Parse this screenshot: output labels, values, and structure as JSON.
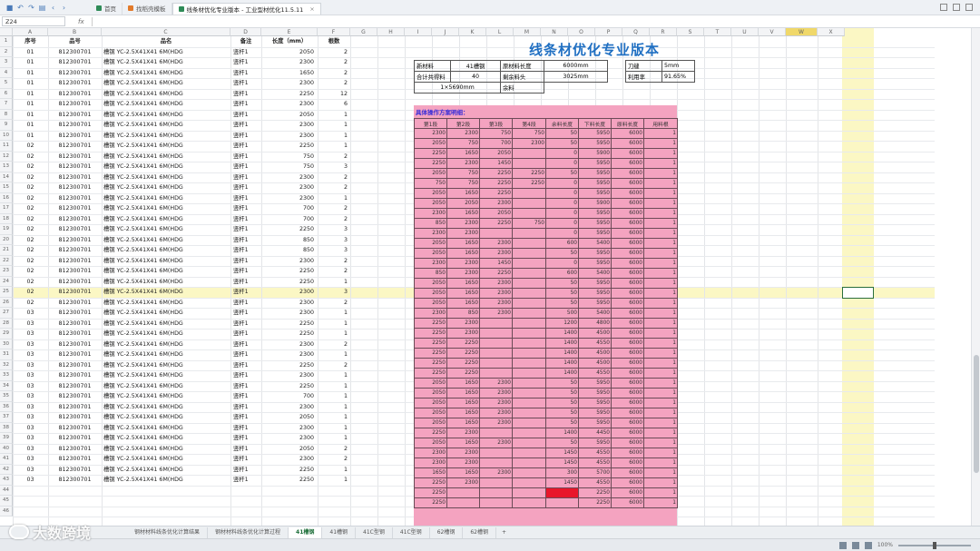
{
  "app": {
    "tabs": [
      {
        "label": "首页",
        "active": false
      },
      {
        "label": "找稻壳模板",
        "active": false
      },
      {
        "label": "线条材优化专业版本 - 工业型材优化11.5.11",
        "active": true
      }
    ]
  },
  "formula_bar": {
    "name_box": "Z24",
    "fx": "fx"
  },
  "columns": [
    "A",
    "B",
    "C",
    "D",
    "E",
    "F",
    "G",
    "H",
    "I",
    "J",
    "K",
    "L",
    "M",
    "N",
    "O",
    "P",
    "Q",
    "R",
    "S",
    "T",
    "U",
    "V",
    "W",
    "X"
  ],
  "table": {
    "headers": {
      "seq": "序号",
      "part": "品号",
      "name": "品名",
      "remark": "备注",
      "length": "长度（mm）",
      "qty": "根数"
    },
    "rows": [
      {
        "seq": "01",
        "part": "812300701",
        "name": "槽钢 YC-2.5X41X41 6M(HDG",
        "rem": "竖杆1",
        "len": "2050",
        "qty": "2"
      },
      {
        "seq": "01",
        "part": "812300701",
        "name": "槽钢 YC-2.5X41X41 6M(HDG",
        "rem": "竖杆1",
        "len": "2300",
        "qty": "2"
      },
      {
        "seq": "01",
        "part": "812300701",
        "name": "槽钢 YC-2.5X41X41 6M(HDG",
        "rem": "竖杆1",
        "len": "1650",
        "qty": "2"
      },
      {
        "seq": "01",
        "part": "812300701",
        "name": "槽钢 YC-2.5X41X41 6M(HDG",
        "rem": "竖杆1",
        "len": "2300",
        "qty": "2"
      },
      {
        "seq": "01",
        "part": "812300701",
        "name": "槽钢 YC-2.5X41X41 6M(HDG",
        "rem": "竖杆1",
        "len": "2250",
        "qty": "12"
      },
      {
        "seq": "01",
        "part": "812300701",
        "name": "槽钢 YC-2.5X41X41 6M(HDG",
        "rem": "竖杆1",
        "len": "2300",
        "qty": "6"
      },
      {
        "seq": "01",
        "part": "812300701",
        "name": "槽钢 YC-2.5X41X41 6M(HDG",
        "rem": "竖杆1",
        "len": "2050",
        "qty": "1"
      },
      {
        "seq": "01",
        "part": "812300701",
        "name": "槽钢 YC-2.5X41X41 6M(HDG",
        "rem": "竖杆1",
        "len": "2300",
        "qty": "1"
      },
      {
        "seq": "01",
        "part": "812300701",
        "name": "槽钢 YC-2.5X41X41 6M(HDG",
        "rem": "竖杆1",
        "len": "2300",
        "qty": "1"
      },
      {
        "seq": "02",
        "part": "812300701",
        "name": "槽钢 YC-2.5X41X41 6M(HDG",
        "rem": "竖杆1",
        "len": "2250",
        "qty": "1"
      },
      {
        "seq": "02",
        "part": "812300701",
        "name": "槽钢 YC-2.5X41X41 6M(HDG",
        "rem": "竖杆1",
        "len": "750",
        "qty": "2"
      },
      {
        "seq": "02",
        "part": "812300701",
        "name": "槽钢 YC-2.5X41X41 6M(HDG",
        "rem": "竖杆1",
        "len": "750",
        "qty": "3"
      },
      {
        "seq": "02",
        "part": "812300701",
        "name": "槽钢 YC-2.5X41X41 6M(HDG",
        "rem": "竖杆1",
        "len": "2300",
        "qty": "2"
      },
      {
        "seq": "02",
        "part": "812300701",
        "name": "槽钢 YC-2.5X41X41 6M(HDG",
        "rem": "竖杆1",
        "len": "2300",
        "qty": "2"
      },
      {
        "seq": "02",
        "part": "812300701",
        "name": "槽钢 YC-2.5X41X41 6M(HDG",
        "rem": "竖杆1",
        "len": "2300",
        "qty": "1"
      },
      {
        "seq": "02",
        "part": "812300701",
        "name": "槽钢 YC-2.5X41X41 6M(HDG",
        "rem": "竖杆1",
        "len": "700",
        "qty": "2"
      },
      {
        "seq": "02",
        "part": "812300701",
        "name": "槽钢 YC-2.5X41X41 6M(HDG",
        "rem": "竖杆1",
        "len": "700",
        "qty": "2"
      },
      {
        "seq": "02",
        "part": "812300701",
        "name": "槽钢 YC-2.5X41X41 6M(HDG",
        "rem": "竖杆1",
        "len": "2250",
        "qty": "3"
      },
      {
        "seq": "02",
        "part": "812300701",
        "name": "槽钢 YC-2.5X41X41 6M(HDG",
        "rem": "竖杆1",
        "len": "850",
        "qty": "3"
      },
      {
        "seq": "02",
        "part": "812300701",
        "name": "槽钢 YC-2.5X41X41 6M(HDG",
        "rem": "竖杆1",
        "len": "850",
        "qty": "3"
      },
      {
        "seq": "02",
        "part": "812300701",
        "name": "槽钢 YC-2.5X41X41 6M(HDG",
        "rem": "竖杆1",
        "len": "2300",
        "qty": "2"
      },
      {
        "seq": "02",
        "part": "812300701",
        "name": "槽钢 YC-2.5X41X41 6M(HDG",
        "rem": "竖杆1",
        "len": "2250",
        "qty": "2"
      },
      {
        "seq": "02",
        "part": "812300701",
        "name": "槽钢 YC-2.5X41X41 6M(HDG",
        "rem": "竖杆1",
        "len": "2250",
        "qty": "1"
      },
      {
        "seq": "02",
        "part": "812300701",
        "name": "槽钢 YC-2.5X41X41 6M(HDG",
        "rem": "竖杆1",
        "len": "2300",
        "qty": "3"
      },
      {
        "seq": "02",
        "part": "812300701",
        "name": "槽钢 YC-2.5X41X41 6M(HDG",
        "rem": "竖杆1",
        "len": "2300",
        "qty": "2"
      },
      {
        "seq": "03",
        "part": "812300701",
        "name": "槽钢 YC-2.5X41X41 6M(HDG",
        "rem": "竖杆1",
        "len": "2300",
        "qty": "1"
      },
      {
        "seq": "03",
        "part": "812300701",
        "name": "槽钢 YC-2.5X41X41 6M(HDG",
        "rem": "竖杆1",
        "len": "2250",
        "qty": "1"
      },
      {
        "seq": "03",
        "part": "812300701",
        "name": "槽钢 YC-2.5X41X41 6M(HDG",
        "rem": "竖杆1",
        "len": "2250",
        "qty": "1"
      },
      {
        "seq": "03",
        "part": "812300701",
        "name": "槽钢 YC-2.5X41X41 6M(HDG",
        "rem": "竖杆1",
        "len": "2300",
        "qty": "2"
      },
      {
        "seq": "03",
        "part": "812300701",
        "name": "槽钢 YC-2.5X41X41 6M(HDG",
        "rem": "竖杆1",
        "len": "2300",
        "qty": "1"
      },
      {
        "seq": "03",
        "part": "812300701",
        "name": "槽钢 YC-2.5X41X41 6M(HDG",
        "rem": "竖杆1",
        "len": "2250",
        "qty": "2"
      },
      {
        "seq": "03",
        "part": "812300701",
        "name": "槽钢 YC-2.5X41X41 6M(HDG",
        "rem": "竖杆1",
        "len": "2300",
        "qty": "1"
      },
      {
        "seq": "03",
        "part": "812300701",
        "name": "槽钢 YC-2.5X41X41 6M(HDG",
        "rem": "竖杆1",
        "len": "2250",
        "qty": "1"
      },
      {
        "seq": "03",
        "part": "812300701",
        "name": "槽钢 YC-2.5X41X41 6M(HDG",
        "rem": "竖杆1",
        "len": "700",
        "qty": "1"
      },
      {
        "seq": "03",
        "part": "812300701",
        "name": "槽钢 YC-2.5X41X41 6M(HDG",
        "rem": "竖杆1",
        "len": "2300",
        "qty": "1"
      },
      {
        "seq": "03",
        "part": "812300701",
        "name": "槽钢 YC-2.5X41X41 6M(HDG",
        "rem": "竖杆1",
        "len": "2050",
        "qty": "1"
      },
      {
        "seq": "03",
        "part": "812300701",
        "name": "槽钢 YC-2.5X41X41 6M(HDG",
        "rem": "竖杆1",
        "len": "2300",
        "qty": "1"
      },
      {
        "seq": "03",
        "part": "812300701",
        "name": "槽钢 YC-2.5X41X41 6M(HDG",
        "rem": "竖杆1",
        "len": "2300",
        "qty": "1"
      },
      {
        "seq": "03",
        "part": "812300701",
        "name": "槽钢 YC-2.5X41X41 6M(HDG",
        "rem": "竖杆1",
        "len": "2050",
        "qty": "2"
      },
      {
        "seq": "03",
        "part": "812300701",
        "name": "槽钢 YC-2.5X41X41 6M(HDG",
        "rem": "竖杆1",
        "len": "2300",
        "qty": "2"
      },
      {
        "seq": "03",
        "part": "812300701",
        "name": "槽钢 YC-2.5X41X41 6M(HDG",
        "rem": "竖杆1",
        "len": "2250",
        "qty": "1"
      },
      {
        "seq": "03",
        "part": "812300701",
        "name": "槽钢 YC-2.5X41X41 6M(HDG",
        "rem": "竖杆1",
        "len": "2250",
        "qty": "1"
      }
    ]
  },
  "panel": {
    "title": "线条材优化专业版本",
    "info": {
      "material_label": "新材料",
      "material_value": "41槽钢",
      "stock_len_label": "原材料长度",
      "stock_len_value": "6000mm",
      "blade_label": "刀缝",
      "blade_value": "5mm",
      "total_label": "合计共得料",
      "total_value": "40",
      "surplus_label": "剩余料头",
      "surplus_value": "3025mm",
      "rate_label": "利用率",
      "rate_value": "91.65%",
      "extra_value": "1×5690mm",
      "extra_label": "余料"
    },
    "plan_title": "具体操作方案明细：",
    "plan_headers": [
      "第1段",
      "第2段",
      "第3段",
      "第4段",
      "余料长度",
      "下料长度",
      "原料长度",
      "用料根"
    ],
    "plan_rows": [
      [
        "2300",
        "2300",
        "750",
        "750",
        "50",
        "5950",
        "6000",
        "1"
      ],
      [
        "2050",
        "750",
        "700",
        "2300",
        "50",
        "5950",
        "6000",
        "1"
      ],
      [
        "2250",
        "1650",
        "2050",
        "",
        "0",
        "5900",
        "6000",
        "1"
      ],
      [
        "2250",
        "2300",
        "1450",
        "",
        "0",
        "5950",
        "6000",
        "1"
      ],
      [
        "2050",
        "750",
        "2250",
        "2250",
        "50",
        "5950",
        "6000",
        "1"
      ],
      [
        "750",
        "750",
        "2250",
        "2250",
        "0",
        "5950",
        "6000",
        "1"
      ],
      [
        "2050",
        "1650",
        "2250",
        "",
        "0",
        "5950",
        "6000",
        "1"
      ],
      [
        "2050",
        "2050",
        "2300",
        "",
        "0",
        "5900",
        "6000",
        "1"
      ],
      [
        "2300",
        "1650",
        "2050",
        "",
        "0",
        "5950",
        "6000",
        "1"
      ],
      [
        "850",
        "2300",
        "2250",
        "750",
        "0",
        "5950",
        "6000",
        "1"
      ],
      [
        "2300",
        "2300",
        "",
        "",
        "0",
        "5950",
        "6000",
        "1"
      ],
      [
        "2050",
        "1650",
        "2300",
        "",
        "600",
        "5400",
        "6000",
        "1"
      ],
      [
        "2050",
        "1650",
        "2300",
        "",
        "50",
        "5950",
        "6000",
        "1"
      ],
      [
        "2300",
        "2300",
        "1450",
        "",
        "0",
        "5950",
        "6000",
        "1"
      ],
      [
        "850",
        "2300",
        "2250",
        "",
        "600",
        "5400",
        "6000",
        "1"
      ],
      [
        "2050",
        "1650",
        "2300",
        "",
        "50",
        "5950",
        "6000",
        "1"
      ],
      [
        "2050",
        "1650",
        "2300",
        "",
        "50",
        "5950",
        "6000",
        "1"
      ],
      [
        "2050",
        "1650",
        "2300",
        "",
        "50",
        "5950",
        "6000",
        "1"
      ],
      [
        "2300",
        "850",
        "2300",
        "",
        "500",
        "5400",
        "6000",
        "1"
      ],
      [
        "2250",
        "2300",
        "",
        "",
        "1200",
        "4800",
        "6000",
        "1"
      ],
      [
        "2250",
        "2300",
        "",
        "",
        "1400",
        "4500",
        "6000",
        "1"
      ],
      [
        "2250",
        "2250",
        "",
        "",
        "1400",
        "4550",
        "6000",
        "1"
      ],
      [
        "2250",
        "2250",
        "",
        "",
        "1400",
        "4500",
        "6000",
        "1"
      ],
      [
        "2250",
        "2250",
        "",
        "",
        "1400",
        "4500",
        "6000",
        "1"
      ],
      [
        "2250",
        "2250",
        "",
        "",
        "1400",
        "4550",
        "6000",
        "1"
      ],
      [
        "2050",
        "1650",
        "2300",
        "",
        "50",
        "5950",
        "6000",
        "1"
      ],
      [
        "2050",
        "1650",
        "2300",
        "",
        "50",
        "5950",
        "6000",
        "1"
      ],
      [
        "2050",
        "1650",
        "2300",
        "",
        "50",
        "5950",
        "6000",
        "1"
      ],
      [
        "2050",
        "1650",
        "2300",
        "",
        "50",
        "5950",
        "6000",
        "1"
      ],
      [
        "2050",
        "1650",
        "2300",
        "",
        "50",
        "5950",
        "6000",
        "1"
      ],
      [
        "2250",
        "2300",
        "",
        "",
        "1400",
        "4450",
        "6000",
        "1"
      ],
      [
        "2050",
        "1650",
        "2300",
        "",
        "50",
        "5950",
        "6000",
        "1"
      ],
      [
        "2300",
        "2300",
        "",
        "",
        "1450",
        "4550",
        "6000",
        "1"
      ],
      [
        "2300",
        "2300",
        "",
        "",
        "1450",
        "4550",
        "6000",
        "1"
      ],
      [
        "1650",
        "1650",
        "2300",
        "",
        "300",
        "5700",
        "6000",
        "1"
      ],
      [
        "2250",
        "2300",
        "",
        "",
        "1450",
        "4550",
        "6000",
        "1"
      ],
      [
        "2250",
        "",
        "",
        "",
        "",
        "2250",
        "6000",
        "1"
      ],
      [
        "2250",
        "",
        "",
        "",
        "",
        "2250",
        "6000",
        "1"
      ]
    ]
  },
  "sheet_tabs": [
    {
      "label": "钢材材料线条优化计算结果",
      "active": false
    },
    {
      "label": "钢材材料线条优化计算过程",
      "active": false
    },
    {
      "label": "41槽钢",
      "active": true
    },
    {
      "label": "41槽钢",
      "active": false
    },
    {
      "label": "41C型钢",
      "active": false
    },
    {
      "label": "41C型钢",
      "active": false
    },
    {
      "label": "62槽钢",
      "active": false
    },
    {
      "label": "62槽钢",
      "active": false
    }
  ],
  "status": {
    "zoom": "100%"
  },
  "watermark": "大数跨境",
  "colors": {
    "accent": "#1f6fc2",
    "pink": "#f4a3c0",
    "highlight": "#fbf7c4"
  }
}
